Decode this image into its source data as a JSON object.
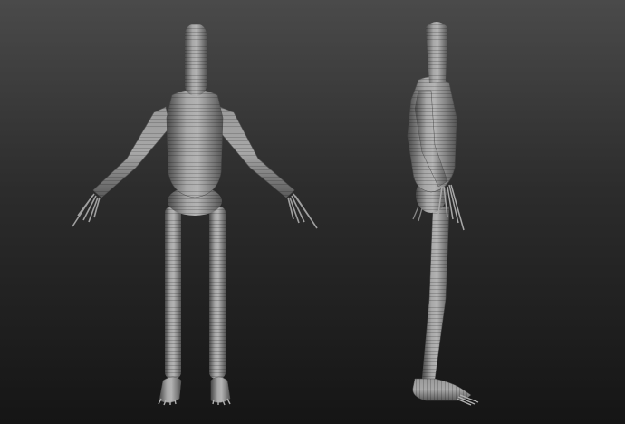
{
  "scene": {
    "views": [
      {
        "name": "front-view"
      },
      {
        "name": "side-view"
      }
    ],
    "colors": {
      "background_top": "#4a4a4a",
      "background_bottom": "#151515",
      "mesh_light": "#b4b4b4",
      "mesh_mid": "#8a8a8a",
      "mesh_dark": "#4a4a4a"
    }
  }
}
